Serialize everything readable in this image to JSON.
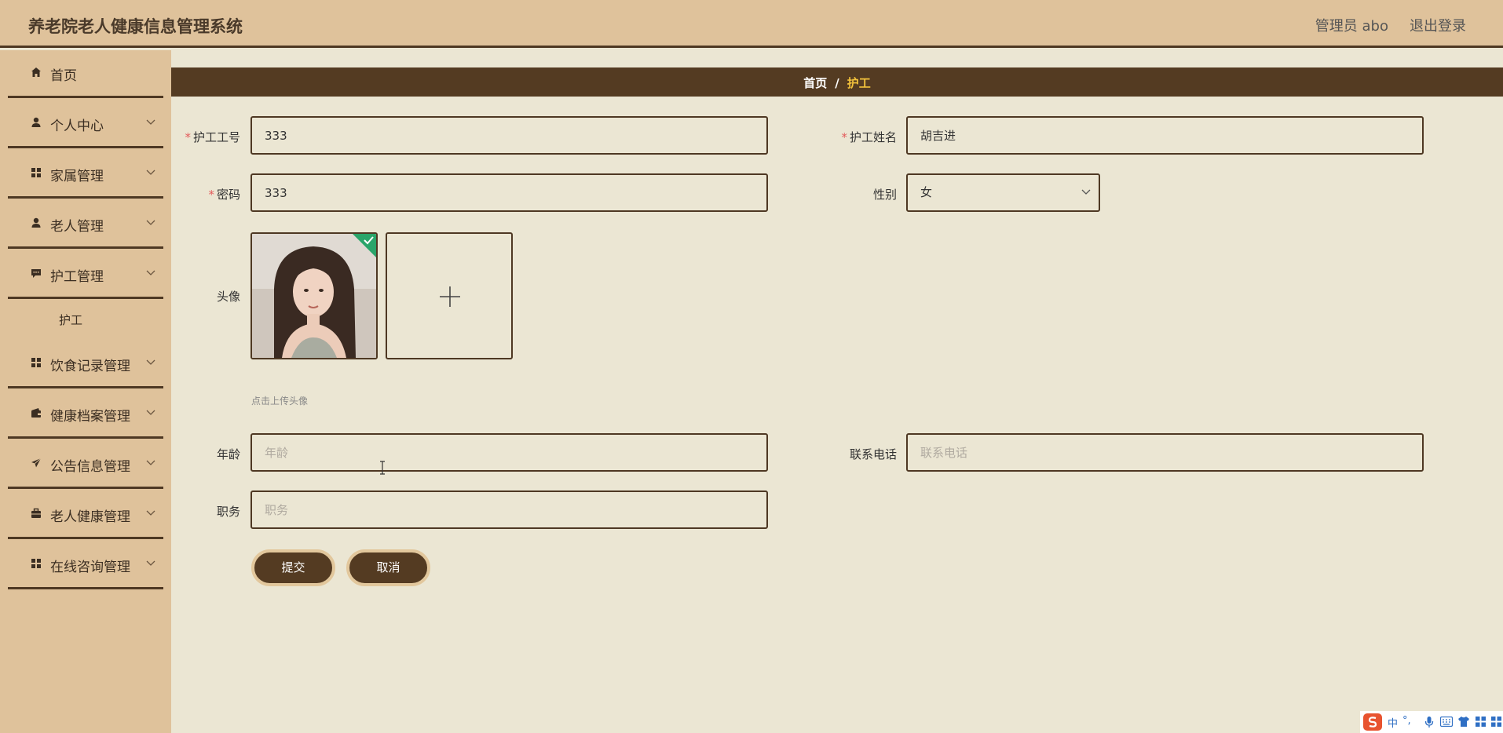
{
  "app": {
    "title": "养老院老人健康信息管理系统"
  },
  "header": {
    "user_label": "管理员 abo",
    "logout_label": "退出登录"
  },
  "sidebar": {
    "items": [
      {
        "label": "首页",
        "icon": "home-icon"
      },
      {
        "label": "个人中心",
        "icon": "user-icon"
      },
      {
        "label": "家属管理",
        "icon": "grid-icon"
      },
      {
        "label": "老人管理",
        "icon": "user-icon"
      },
      {
        "label": "护工管理",
        "icon": "chat-icon"
      },
      {
        "label": "饮食记录管理",
        "icon": "grid-icon"
      },
      {
        "label": "健康档案管理",
        "icon": "wallet-icon"
      },
      {
        "label": "公告信息管理",
        "icon": "send-icon"
      },
      {
        "label": "老人健康管理",
        "icon": "briefcase-icon"
      },
      {
        "label": "在线咨询管理",
        "icon": "grid-icon"
      }
    ],
    "submenu": {
      "label": "护工"
    }
  },
  "breadcrumb": {
    "home": "首页",
    "separator": "/",
    "current": "护工"
  },
  "form": {
    "worker_no": {
      "label": "护工工号",
      "value": "333"
    },
    "worker_name": {
      "label": "护工姓名",
      "value": "胡吉进"
    },
    "password": {
      "label": "密码",
      "value": "333"
    },
    "gender": {
      "label": "性别",
      "value": "女"
    },
    "avatar": {
      "label": "头像",
      "hint": "点击上传头像"
    },
    "age": {
      "label": "年龄",
      "placeholder": "年龄"
    },
    "phone": {
      "label": "联系电话",
      "placeholder": "联系电话"
    },
    "position": {
      "label": "职务",
      "placeholder": "职务"
    },
    "submit_label": "提交",
    "cancel_label": "取消"
  },
  "ime": {
    "lang": "中",
    "punct": "°,"
  },
  "colors": {
    "header_bg": "#dfc29b",
    "sidebar_bg": "#dfc29b",
    "accent_dark": "#543b22",
    "breadcrumb_current": "#f3c23c",
    "page_bg": "#ebe6d3",
    "required": "#e35b5b"
  }
}
